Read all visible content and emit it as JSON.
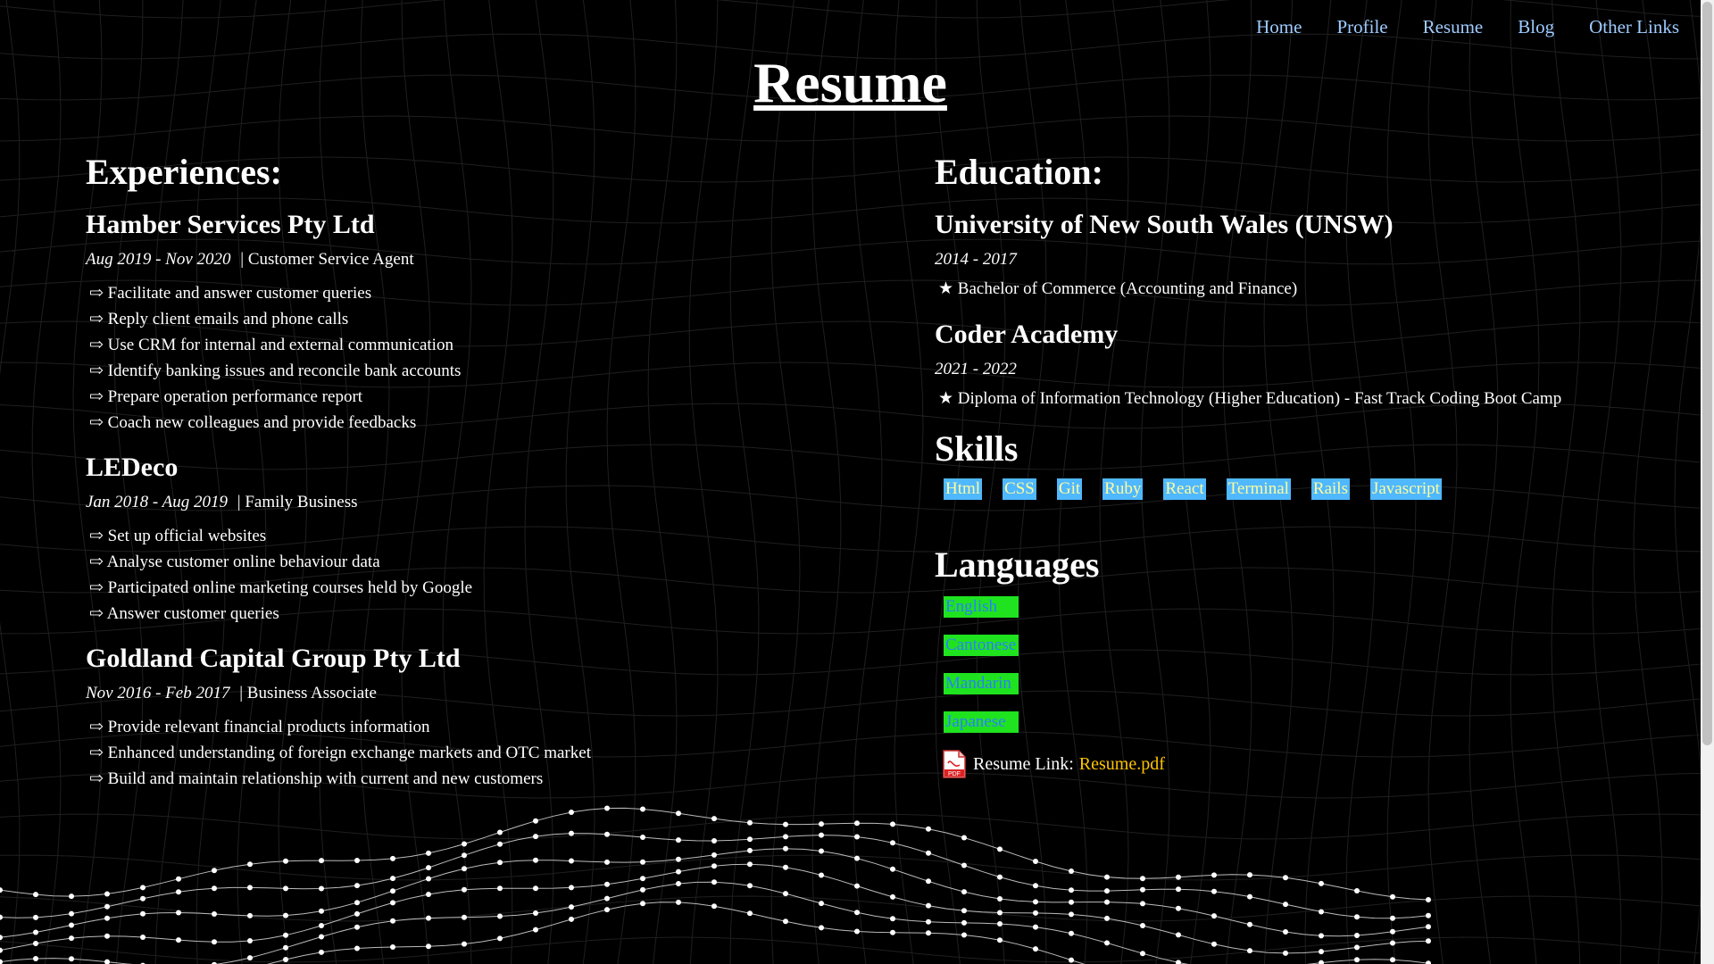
{
  "nav": {
    "items": [
      "Home",
      "Profile",
      "Resume",
      "Blog",
      "Other Links"
    ]
  },
  "page_title": "Resume",
  "experiences": {
    "heading": "Experiences:",
    "jobs": [
      {
        "company": "Hamber Services Pty Ltd",
        "period": "Aug 2019 - Nov 2020",
        "role": "| Customer Service Agent",
        "duties": [
          "⇨ Facilitate and answer customer queries",
          "⇨ Reply client emails and phone calls",
          "⇨ Use CRM for internal and external communication",
          "⇨ Identify banking issues and reconcile bank accounts",
          "⇨ Prepare operation performance report",
          "⇨ Coach new colleagues and provide feedbacks"
        ]
      },
      {
        "company": "LEDeco",
        "period": "Jan 2018 - Aug 2019",
        "role": "| Family Business",
        "duties": [
          "⇨ Set up official websites",
          "⇨ Analyse customer online behaviour data",
          "⇨ Participated online marketing courses held by Google",
          "⇨ Answer customer queries"
        ]
      },
      {
        "company": "Goldland Capital Group Pty Ltd",
        "period": "Nov 2016 - Feb 2017",
        "role": "| Business Associate",
        "duties": [
          "⇨ Provide relevant financial products information",
          "⇨ Enhanced understanding of foreign exchange markets and OTC market",
          "⇨ Build and maintain relationship with current and new customers"
        ]
      }
    ]
  },
  "education": {
    "heading": "Education:",
    "schools": [
      {
        "name": "University of New South Wales (UNSW)",
        "period": "2014 - 2017",
        "item": "★ Bachelor of Commerce (Accounting and Finance)"
      },
      {
        "name": "Coder Academy",
        "period": "2021 - 2022",
        "item": "★ Diploma of Information Technology (Higher Education) - Fast Track Coding Boot Camp"
      }
    ]
  },
  "skills": {
    "heading": "Skills",
    "items": [
      "Html",
      "CSS",
      "Git",
      "Ruby",
      "React",
      "Terminal",
      "Rails",
      "Javascript"
    ]
  },
  "languages": {
    "heading": "Languages",
    "items": [
      "English",
      "Cantonese",
      "Mandarin",
      "Japanese"
    ]
  },
  "resume_link": {
    "label": "Resume Link:",
    "link_text": "Resume.pdf",
    "icon": "pdf-icon",
    "icon_text": "PDF"
  },
  "colors": {
    "background": "#000000",
    "nav_link": "#9ecbff",
    "skill_bg": "#4fb8ff",
    "skill_text": "#fffb9c",
    "lang_bg": "#1fe31f",
    "lang_text": "#2b7fff",
    "link": "#ffc400"
  }
}
